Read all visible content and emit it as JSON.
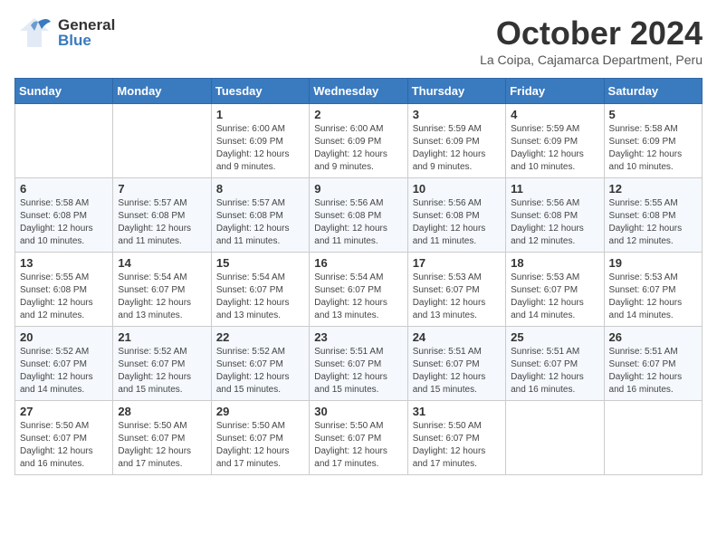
{
  "header": {
    "logo_general": "General",
    "logo_blue": "Blue",
    "month_title": "October 2024",
    "subtitle": "La Coipa, Cajamarca Department, Peru"
  },
  "calendar": {
    "days": [
      "Sunday",
      "Monday",
      "Tuesday",
      "Wednesday",
      "Thursday",
      "Friday",
      "Saturday"
    ],
    "weeks": [
      [
        {
          "day": "",
          "info": ""
        },
        {
          "day": "",
          "info": ""
        },
        {
          "day": "1",
          "info": "Sunrise: 6:00 AM\nSunset: 6:09 PM\nDaylight: 12 hours\nand 9 minutes."
        },
        {
          "day": "2",
          "info": "Sunrise: 6:00 AM\nSunset: 6:09 PM\nDaylight: 12 hours\nand 9 minutes."
        },
        {
          "day": "3",
          "info": "Sunrise: 5:59 AM\nSunset: 6:09 PM\nDaylight: 12 hours\nand 9 minutes."
        },
        {
          "day": "4",
          "info": "Sunrise: 5:59 AM\nSunset: 6:09 PM\nDaylight: 12 hours\nand 10 minutes."
        },
        {
          "day": "5",
          "info": "Sunrise: 5:58 AM\nSunset: 6:09 PM\nDaylight: 12 hours\nand 10 minutes."
        }
      ],
      [
        {
          "day": "6",
          "info": "Sunrise: 5:58 AM\nSunset: 6:08 PM\nDaylight: 12 hours\nand 10 minutes."
        },
        {
          "day": "7",
          "info": "Sunrise: 5:57 AM\nSunset: 6:08 PM\nDaylight: 12 hours\nand 11 minutes."
        },
        {
          "day": "8",
          "info": "Sunrise: 5:57 AM\nSunset: 6:08 PM\nDaylight: 12 hours\nand 11 minutes."
        },
        {
          "day": "9",
          "info": "Sunrise: 5:56 AM\nSunset: 6:08 PM\nDaylight: 12 hours\nand 11 minutes."
        },
        {
          "day": "10",
          "info": "Sunrise: 5:56 AM\nSunset: 6:08 PM\nDaylight: 12 hours\nand 11 minutes."
        },
        {
          "day": "11",
          "info": "Sunrise: 5:56 AM\nSunset: 6:08 PM\nDaylight: 12 hours\nand 12 minutes."
        },
        {
          "day": "12",
          "info": "Sunrise: 5:55 AM\nSunset: 6:08 PM\nDaylight: 12 hours\nand 12 minutes."
        }
      ],
      [
        {
          "day": "13",
          "info": "Sunrise: 5:55 AM\nSunset: 6:08 PM\nDaylight: 12 hours\nand 12 minutes."
        },
        {
          "day": "14",
          "info": "Sunrise: 5:54 AM\nSunset: 6:07 PM\nDaylight: 12 hours\nand 13 minutes."
        },
        {
          "day": "15",
          "info": "Sunrise: 5:54 AM\nSunset: 6:07 PM\nDaylight: 12 hours\nand 13 minutes."
        },
        {
          "day": "16",
          "info": "Sunrise: 5:54 AM\nSunset: 6:07 PM\nDaylight: 12 hours\nand 13 minutes."
        },
        {
          "day": "17",
          "info": "Sunrise: 5:53 AM\nSunset: 6:07 PM\nDaylight: 12 hours\nand 13 minutes."
        },
        {
          "day": "18",
          "info": "Sunrise: 5:53 AM\nSunset: 6:07 PM\nDaylight: 12 hours\nand 14 minutes."
        },
        {
          "day": "19",
          "info": "Sunrise: 5:53 AM\nSunset: 6:07 PM\nDaylight: 12 hours\nand 14 minutes."
        }
      ],
      [
        {
          "day": "20",
          "info": "Sunrise: 5:52 AM\nSunset: 6:07 PM\nDaylight: 12 hours\nand 14 minutes."
        },
        {
          "day": "21",
          "info": "Sunrise: 5:52 AM\nSunset: 6:07 PM\nDaylight: 12 hours\nand 15 minutes."
        },
        {
          "day": "22",
          "info": "Sunrise: 5:52 AM\nSunset: 6:07 PM\nDaylight: 12 hours\nand 15 minutes."
        },
        {
          "day": "23",
          "info": "Sunrise: 5:51 AM\nSunset: 6:07 PM\nDaylight: 12 hours\nand 15 minutes."
        },
        {
          "day": "24",
          "info": "Sunrise: 5:51 AM\nSunset: 6:07 PM\nDaylight: 12 hours\nand 15 minutes."
        },
        {
          "day": "25",
          "info": "Sunrise: 5:51 AM\nSunset: 6:07 PM\nDaylight: 12 hours\nand 16 minutes."
        },
        {
          "day": "26",
          "info": "Sunrise: 5:51 AM\nSunset: 6:07 PM\nDaylight: 12 hours\nand 16 minutes."
        }
      ],
      [
        {
          "day": "27",
          "info": "Sunrise: 5:50 AM\nSunset: 6:07 PM\nDaylight: 12 hours\nand 16 minutes."
        },
        {
          "day": "28",
          "info": "Sunrise: 5:50 AM\nSunset: 6:07 PM\nDaylight: 12 hours\nand 17 minutes."
        },
        {
          "day": "29",
          "info": "Sunrise: 5:50 AM\nSunset: 6:07 PM\nDaylight: 12 hours\nand 17 minutes."
        },
        {
          "day": "30",
          "info": "Sunrise: 5:50 AM\nSunset: 6:07 PM\nDaylight: 12 hours\nand 17 minutes."
        },
        {
          "day": "31",
          "info": "Sunrise: 5:50 AM\nSunset: 6:07 PM\nDaylight: 12 hours\nand 17 minutes."
        },
        {
          "day": "",
          "info": ""
        },
        {
          "day": "",
          "info": ""
        }
      ]
    ]
  }
}
